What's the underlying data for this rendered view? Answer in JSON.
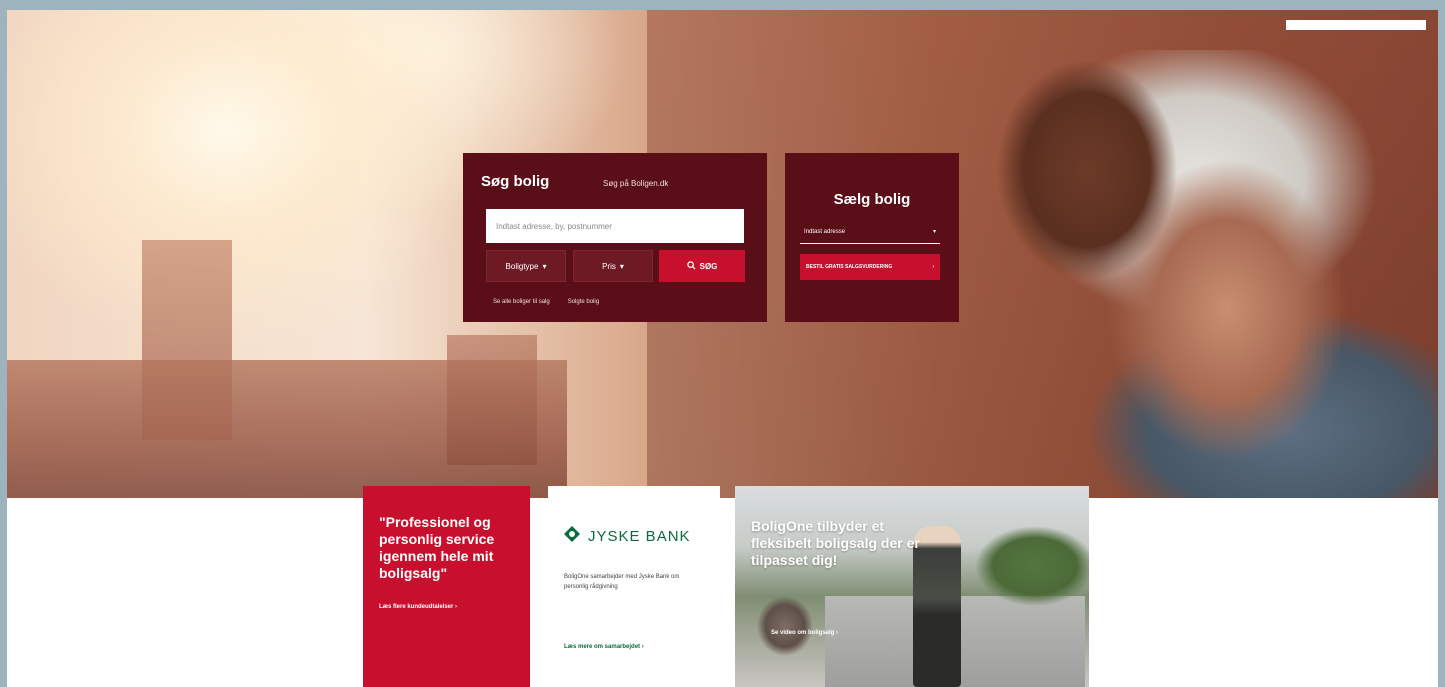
{
  "header": {
    "logo_text": ""
  },
  "search": {
    "title": "Søg bolig",
    "subtitle": "Søg på Boligen.dk",
    "input_placeholder": "Indtast adresse, by, postnummer",
    "type_select": "Boligtype",
    "price_select": "Pris",
    "button_label": "SØG",
    "links": [
      "Se alle boliger til salg",
      "Solgte bolig"
    ]
  },
  "sell": {
    "title": "Sælg bolig",
    "input_placeholder": "Indtast adresse",
    "button_label": "BESTIL GRATIS SALGSVURDERING"
  },
  "cards": {
    "quote": {
      "text": "\"Professionel og personlig service igennem hele mit boligsalg\"",
      "link": "Læs flere kundeudtalelser"
    },
    "bank": {
      "logo": "JYSKE BANK",
      "text": "BoligOne samarbejder med Jyske Bank om personlig rådgivning",
      "link": "Læs mere om samarbejdet"
    },
    "video": {
      "title": "BoligOne tilbyder et fleksibelt boligsalg der er tilpasset dig!",
      "link": "Se video om boligsalg"
    }
  },
  "colors": {
    "panel": "#5a0f18",
    "accent": "#c8102e",
    "bank_green": "#0a6b3e"
  },
  "icons": [
    "search-icon",
    "chevron-down-icon",
    "arrow-right-icon",
    "jyske-logo-icon"
  ]
}
